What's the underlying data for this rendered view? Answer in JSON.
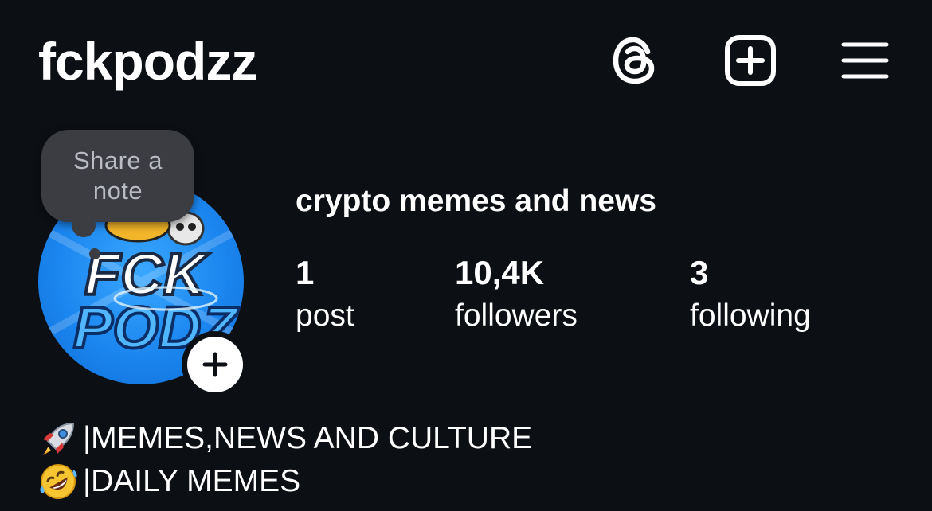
{
  "header": {
    "username": "fckpodzz",
    "icons": [
      "threads-icon",
      "create-post-icon",
      "menu-icon"
    ]
  },
  "note": {
    "placeholder": "Share a note"
  },
  "profile": {
    "display_name": "crypto memes and news",
    "avatar_text": [
      "FCK",
      "PODZ"
    ],
    "stats": [
      {
        "value": "1",
        "label": "post"
      },
      {
        "value": "10,4K",
        "label": "followers"
      },
      {
        "value": "3",
        "label": "following"
      }
    ]
  },
  "bio": {
    "lines": [
      {
        "emoji": "rocket-icon",
        "text": "|MEMES,NEWS AND CULTURE"
      },
      {
        "emoji": "rolling-on-floor-laughing-icon",
        "text": "|DAILY MEMES"
      }
    ]
  },
  "colors": {
    "background": "#0c0f14",
    "text": "#ffffff",
    "note_bubble": "#3b3d42",
    "avatar_blue": "#1b86ef"
  }
}
